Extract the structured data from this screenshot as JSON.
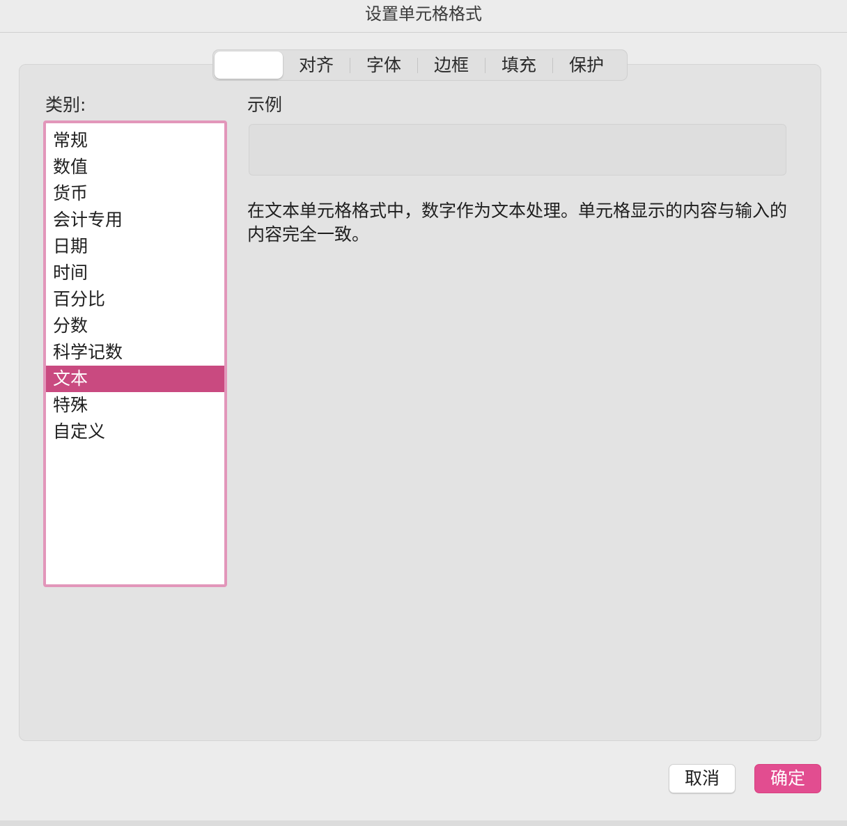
{
  "window": {
    "title": "设置单元格格式"
  },
  "tabs": [
    {
      "label": "",
      "active": true
    },
    {
      "label": "对齐"
    },
    {
      "label": "字体"
    },
    {
      "label": "边框"
    },
    {
      "label": "填充"
    },
    {
      "label": "保护"
    }
  ],
  "category": {
    "label": "类别:",
    "items": [
      "常规",
      "数值",
      "货币",
      "会计专用",
      "日期",
      "时间",
      "百分比",
      "分数",
      "科学记数",
      "文本",
      "特殊",
      "自定义"
    ],
    "selected": "文本"
  },
  "sample": {
    "label": "示例",
    "value": ""
  },
  "description": "在文本单元格格式中，数字作为文本处理。单元格显示的内容与输入的内容完全一致。",
  "buttons": {
    "cancel": "取消",
    "ok": "确定"
  },
  "colors": {
    "accent": "#e24d90",
    "selection": "#c94a80",
    "focus_ring": "#e296ba"
  }
}
